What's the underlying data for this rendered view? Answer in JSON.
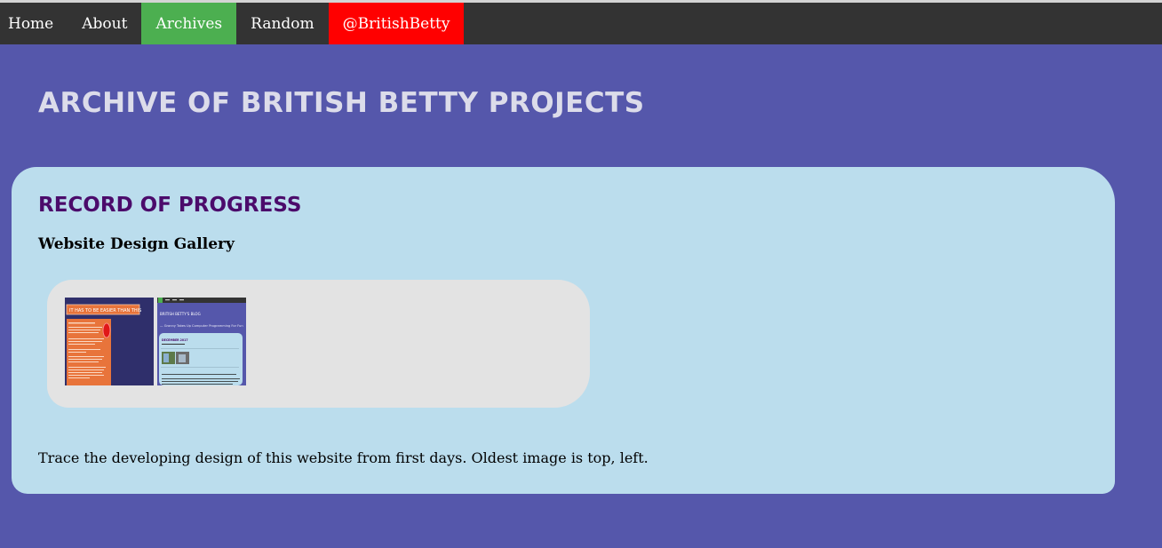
{
  "nav": {
    "items": [
      {
        "label": "Home"
      },
      {
        "label": "About"
      },
      {
        "label": "Archives"
      },
      {
        "label": "Random"
      },
      {
        "label": "@BritishBetty"
      }
    ],
    "active_color": "#4caf50",
    "twitter_color": "#ff0000"
  },
  "page": {
    "title": "ARCHIVE OF BRITISH BETTY PROJECTS",
    "background": "#5557ab"
  },
  "section": {
    "title": "RECORD OF PROGRESS",
    "gallery_heading": "Website Design Gallery",
    "caption": "Trace the developing design of this website from first days. Oldest image is top, left."
  },
  "gallery": {
    "thumbnails": [
      {
        "label": "IT HAS TO BE EASIER THAN THIS"
      },
      {
        "label": "BRITISH BETTY'S BLOG",
        "subtitle": "— Granny Takes Up Computer Programming For Fun"
      }
    ]
  }
}
